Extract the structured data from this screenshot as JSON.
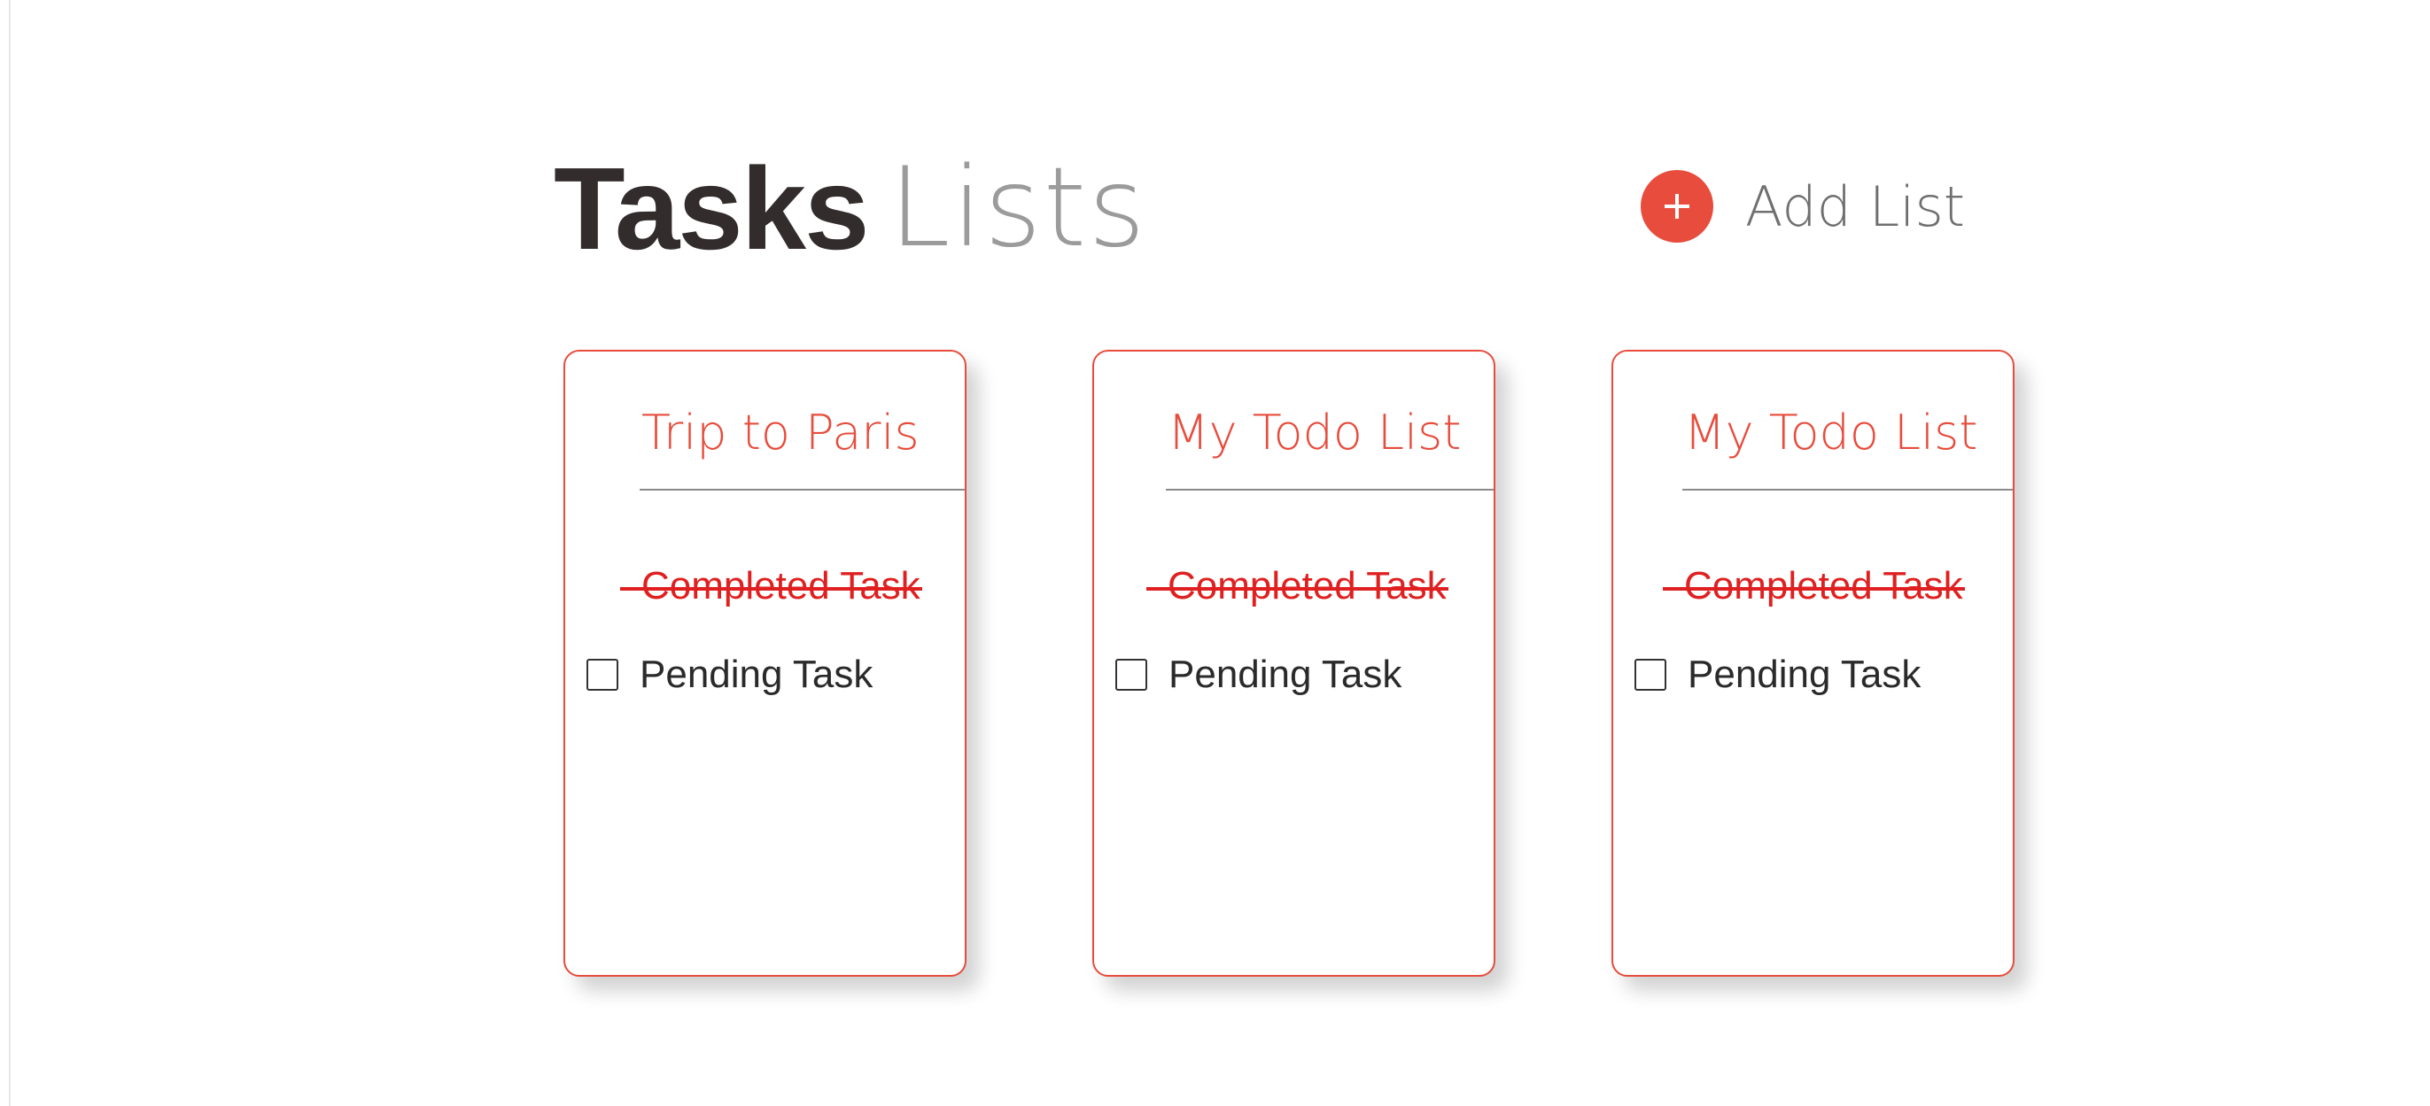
{
  "header": {
    "title_bold": "Tasks",
    "title_light": "Lists"
  },
  "add_list": {
    "label": "Add List",
    "icon": "plus-icon"
  },
  "colors": {
    "accent": "#e74c3c",
    "strike": "#e02020",
    "title_dark": "#332c2c",
    "muted": "#8a8a8a"
  },
  "lists": [
    {
      "title": "Trip to Paris",
      "completed_task": "Completed Task",
      "pending_task": "Pending Task"
    },
    {
      "title": "My Todo List",
      "completed_task": "Completed Task",
      "pending_task": "Pending Task"
    },
    {
      "title": "My Todo List",
      "completed_task": "Completed Task",
      "pending_task": "Pending Task"
    }
  ]
}
